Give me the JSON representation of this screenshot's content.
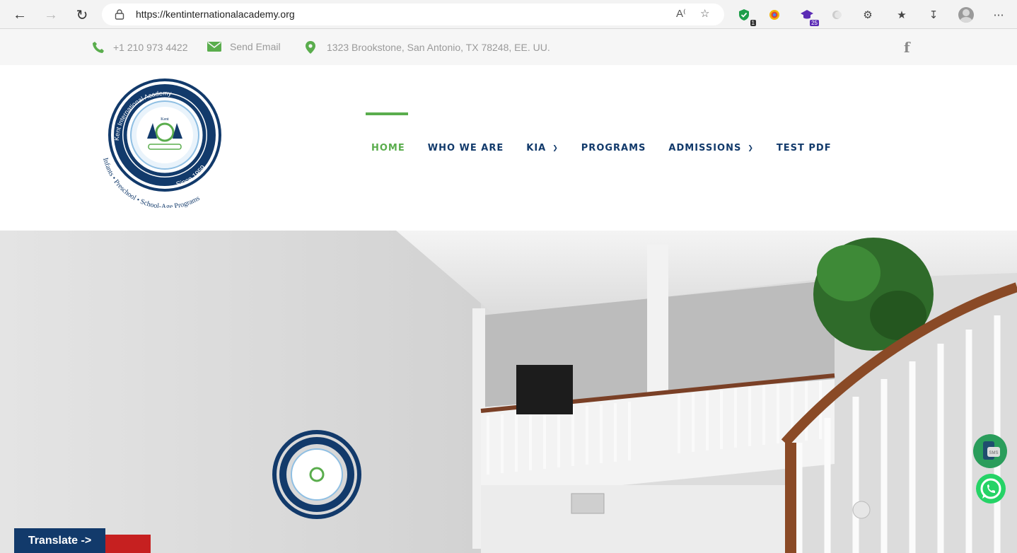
{
  "browser": {
    "url": "https://kentinternationalacademy.org",
    "extensions": [
      {
        "icon": "shield-extension-icon",
        "badge": "1"
      },
      {
        "icon": "colorful-extension-icon",
        "badge": ""
      },
      {
        "icon": "graduation-cap-extension-icon",
        "badge": "25"
      },
      {
        "icon": "grey-extension-icon",
        "badge": ""
      }
    ]
  },
  "topbar": {
    "phone": "+1 210 973 4422",
    "email": "Send Email",
    "address": "1323 Brookstone, San Antonio, TX 78248, EE. UU."
  },
  "logo": {
    "ring_text": "Kent International Academy",
    "since": "Since 1959",
    "bottom_text": "Infants • Preschool • School-Age Programs",
    "crest_name": "Kent"
  },
  "nav": {
    "items": [
      {
        "label": "HOME",
        "active": true,
        "dropdown": false
      },
      {
        "label": "WHO WE ARE",
        "active": false,
        "dropdown": false
      },
      {
        "label": "KIA",
        "active": false,
        "dropdown": true
      },
      {
        "label": "PROGRAMS",
        "active": false,
        "dropdown": false
      },
      {
        "label": "ADMISSIONS",
        "active": false,
        "dropdown": true
      },
      {
        "label": "TEST PDF",
        "active": false,
        "dropdown": false
      }
    ]
  },
  "floating": {
    "sms_label": "SMS",
    "translate": "Translate ->"
  },
  "colors": {
    "brand_navy": "#123a6b",
    "brand_green": "#5aad4d",
    "whatsapp_green": "#25d366"
  }
}
